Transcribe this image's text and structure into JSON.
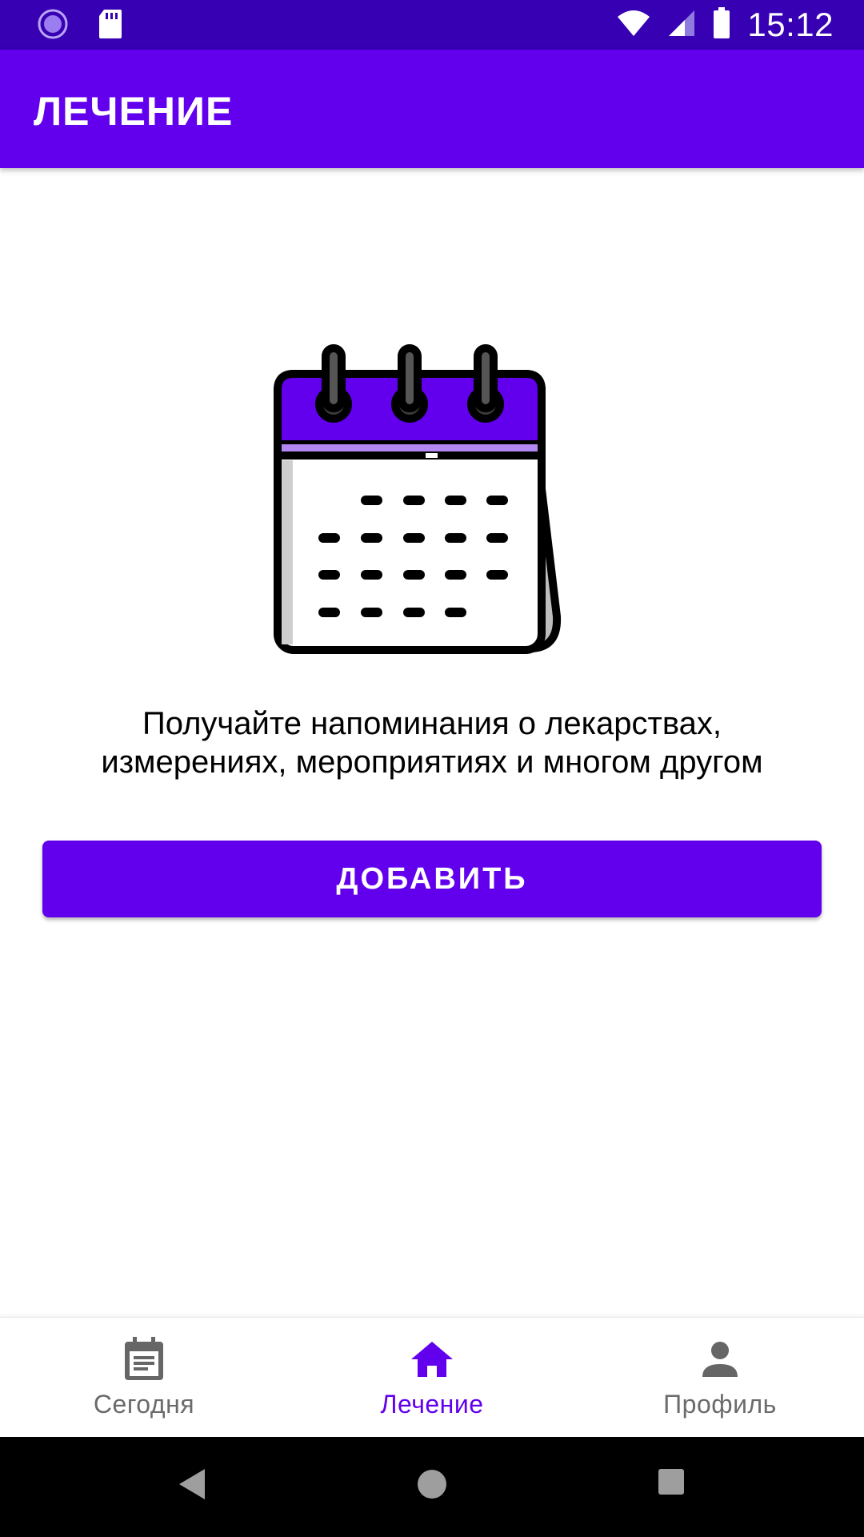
{
  "status_bar": {
    "time": "15:12",
    "left_icons": [
      "loading-circle-icon",
      "sd-card-icon"
    ],
    "right_icons": [
      "wifi-icon",
      "cell-signal-icon",
      "battery-icon"
    ]
  },
  "app_bar": {
    "title": "ЛЕЧЕНИЕ",
    "color": "#6200ee"
  },
  "empty_state": {
    "icon": "calendar-illustration",
    "line1": "Получайте напоминания о лекарствах,",
    "line2": "измерениях, мероприятиях и многом другом",
    "button_label": "ДОБАВИТЬ"
  },
  "bottom_nav": {
    "items": [
      {
        "label": "Сегодня",
        "icon": "calendar-today-icon",
        "active": false
      },
      {
        "label": "Лечение",
        "icon": "home-icon",
        "active": true
      },
      {
        "label": "Профиль",
        "icon": "person-icon",
        "active": false
      }
    ]
  },
  "system_nav": {
    "buttons": [
      "back-icon",
      "home-circle-icon",
      "recents-icon"
    ]
  },
  "colors": {
    "status_bar": "#3700b3",
    "primary": "#6200ee",
    "inactive": "#6b6b6b"
  }
}
